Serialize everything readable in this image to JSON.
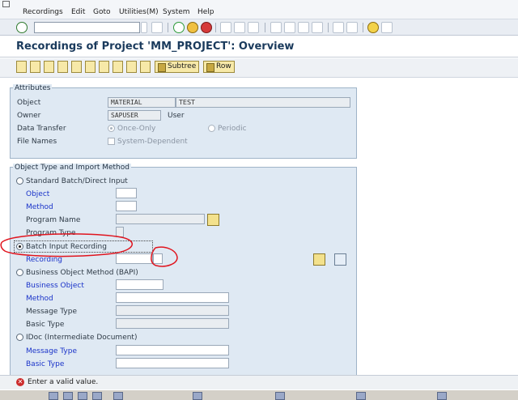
{
  "menu": [
    "Recordings",
    "Edit",
    "Goto",
    "Utilities(M)",
    "System",
    "Help"
  ],
  "page_title": "Recordings of Project 'MM_PROJECT': Overview",
  "app_toolbar": {
    "subtree_label": "Subtree",
    "row_label": "Row"
  },
  "attributes": {
    "title": "Attributes",
    "object_label": "Object",
    "object_value": "MATERIAL",
    "object_text": "TEST",
    "owner_label": "Owner",
    "owner_value": "SAPUSER",
    "owner_text": "User",
    "data_transfer_label": "Data Transfer",
    "once_only": "Once-Only",
    "periodic": "Periodic",
    "file_names_label": "File Names",
    "system_dependent": "System-Dependent"
  },
  "import_method": {
    "title": "Object Type and Import Method",
    "standard_batch": "Standard Batch/Direct Input",
    "object_label": "Object",
    "method_label": "Method",
    "program_name_label": "Program Name",
    "program_type_label": "Program Type",
    "batch_input_recording": "Batch Input Recording",
    "recording_label": "Recording",
    "bapi": "Business Object Method  (BAPI)",
    "business_object_label": "Business Object",
    "bapi_method_label": "Method",
    "message_type_label": "Message Type",
    "basic_type_label": "Basic Type",
    "idoc": "IDoc (Intermediate Document)",
    "idoc_message_type_label": "Message Type",
    "idoc_basic_type_label": "Basic Type"
  },
  "status": {
    "message": "Enter a valid value."
  },
  "colors": {
    "annotation_red": "#e0141e",
    "title_blue": "#1a3a5c",
    "group_bg": "#dfe9f3"
  }
}
